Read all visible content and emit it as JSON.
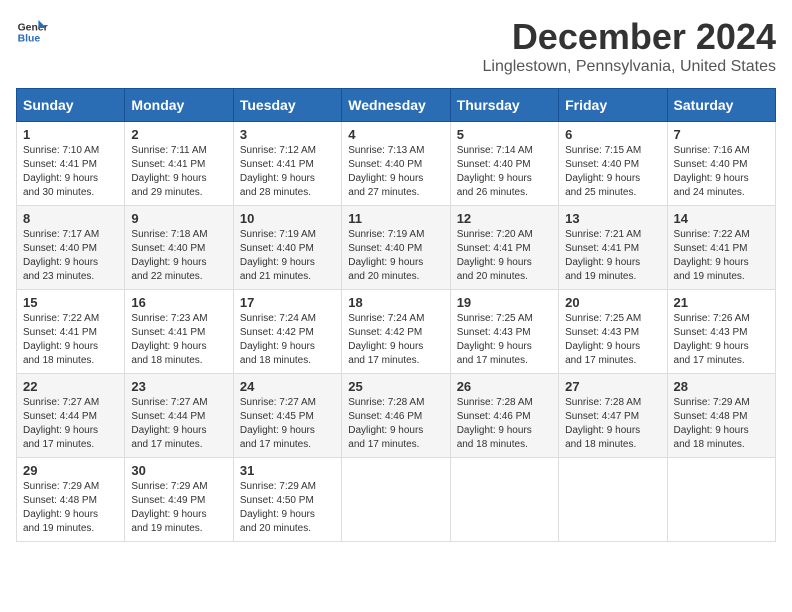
{
  "logo": {
    "line1": "General",
    "line2": "Blue"
  },
  "title": "December 2024",
  "location": "Linglestown, Pennsylvania, United States",
  "days_of_week": [
    "Sunday",
    "Monday",
    "Tuesday",
    "Wednesday",
    "Thursday",
    "Friday",
    "Saturday"
  ],
  "weeks": [
    [
      {
        "day": "1",
        "info": "Sunrise: 7:10 AM\nSunset: 4:41 PM\nDaylight: 9 hours\nand 30 minutes."
      },
      {
        "day": "2",
        "info": "Sunrise: 7:11 AM\nSunset: 4:41 PM\nDaylight: 9 hours\nand 29 minutes."
      },
      {
        "day": "3",
        "info": "Sunrise: 7:12 AM\nSunset: 4:41 PM\nDaylight: 9 hours\nand 28 minutes."
      },
      {
        "day": "4",
        "info": "Sunrise: 7:13 AM\nSunset: 4:40 PM\nDaylight: 9 hours\nand 27 minutes."
      },
      {
        "day": "5",
        "info": "Sunrise: 7:14 AM\nSunset: 4:40 PM\nDaylight: 9 hours\nand 26 minutes."
      },
      {
        "day": "6",
        "info": "Sunrise: 7:15 AM\nSunset: 4:40 PM\nDaylight: 9 hours\nand 25 minutes."
      },
      {
        "day": "7",
        "info": "Sunrise: 7:16 AM\nSunset: 4:40 PM\nDaylight: 9 hours\nand 24 minutes."
      }
    ],
    [
      {
        "day": "8",
        "info": "Sunrise: 7:17 AM\nSunset: 4:40 PM\nDaylight: 9 hours\nand 23 minutes."
      },
      {
        "day": "9",
        "info": "Sunrise: 7:18 AM\nSunset: 4:40 PM\nDaylight: 9 hours\nand 22 minutes."
      },
      {
        "day": "10",
        "info": "Sunrise: 7:19 AM\nSunset: 4:40 PM\nDaylight: 9 hours\nand 21 minutes."
      },
      {
        "day": "11",
        "info": "Sunrise: 7:19 AM\nSunset: 4:40 PM\nDaylight: 9 hours\nand 20 minutes."
      },
      {
        "day": "12",
        "info": "Sunrise: 7:20 AM\nSunset: 4:41 PM\nDaylight: 9 hours\nand 20 minutes."
      },
      {
        "day": "13",
        "info": "Sunrise: 7:21 AM\nSunset: 4:41 PM\nDaylight: 9 hours\nand 19 minutes."
      },
      {
        "day": "14",
        "info": "Sunrise: 7:22 AM\nSunset: 4:41 PM\nDaylight: 9 hours\nand 19 minutes."
      }
    ],
    [
      {
        "day": "15",
        "info": "Sunrise: 7:22 AM\nSunset: 4:41 PM\nDaylight: 9 hours\nand 18 minutes."
      },
      {
        "day": "16",
        "info": "Sunrise: 7:23 AM\nSunset: 4:41 PM\nDaylight: 9 hours\nand 18 minutes."
      },
      {
        "day": "17",
        "info": "Sunrise: 7:24 AM\nSunset: 4:42 PM\nDaylight: 9 hours\nand 18 minutes."
      },
      {
        "day": "18",
        "info": "Sunrise: 7:24 AM\nSunset: 4:42 PM\nDaylight: 9 hours\nand 17 minutes."
      },
      {
        "day": "19",
        "info": "Sunrise: 7:25 AM\nSunset: 4:43 PM\nDaylight: 9 hours\nand 17 minutes."
      },
      {
        "day": "20",
        "info": "Sunrise: 7:25 AM\nSunset: 4:43 PM\nDaylight: 9 hours\nand 17 minutes."
      },
      {
        "day": "21",
        "info": "Sunrise: 7:26 AM\nSunset: 4:43 PM\nDaylight: 9 hours\nand 17 minutes."
      }
    ],
    [
      {
        "day": "22",
        "info": "Sunrise: 7:27 AM\nSunset: 4:44 PM\nDaylight: 9 hours\nand 17 minutes."
      },
      {
        "day": "23",
        "info": "Sunrise: 7:27 AM\nSunset: 4:44 PM\nDaylight: 9 hours\nand 17 minutes."
      },
      {
        "day": "24",
        "info": "Sunrise: 7:27 AM\nSunset: 4:45 PM\nDaylight: 9 hours\nand 17 minutes."
      },
      {
        "day": "25",
        "info": "Sunrise: 7:28 AM\nSunset: 4:46 PM\nDaylight: 9 hours\nand 17 minutes."
      },
      {
        "day": "26",
        "info": "Sunrise: 7:28 AM\nSunset: 4:46 PM\nDaylight: 9 hours\nand 18 minutes."
      },
      {
        "day": "27",
        "info": "Sunrise: 7:28 AM\nSunset: 4:47 PM\nDaylight: 9 hours\nand 18 minutes."
      },
      {
        "day": "28",
        "info": "Sunrise: 7:29 AM\nSunset: 4:48 PM\nDaylight: 9 hours\nand 18 minutes."
      }
    ],
    [
      {
        "day": "29",
        "info": "Sunrise: 7:29 AM\nSunset: 4:48 PM\nDaylight: 9 hours\nand 19 minutes."
      },
      {
        "day": "30",
        "info": "Sunrise: 7:29 AM\nSunset: 4:49 PM\nDaylight: 9 hours\nand 19 minutes."
      },
      {
        "day": "31",
        "info": "Sunrise: 7:29 AM\nSunset: 4:50 PM\nDaylight: 9 hours\nand 20 minutes."
      },
      {
        "day": "",
        "info": ""
      },
      {
        "day": "",
        "info": ""
      },
      {
        "day": "",
        "info": ""
      },
      {
        "day": "",
        "info": ""
      }
    ]
  ]
}
